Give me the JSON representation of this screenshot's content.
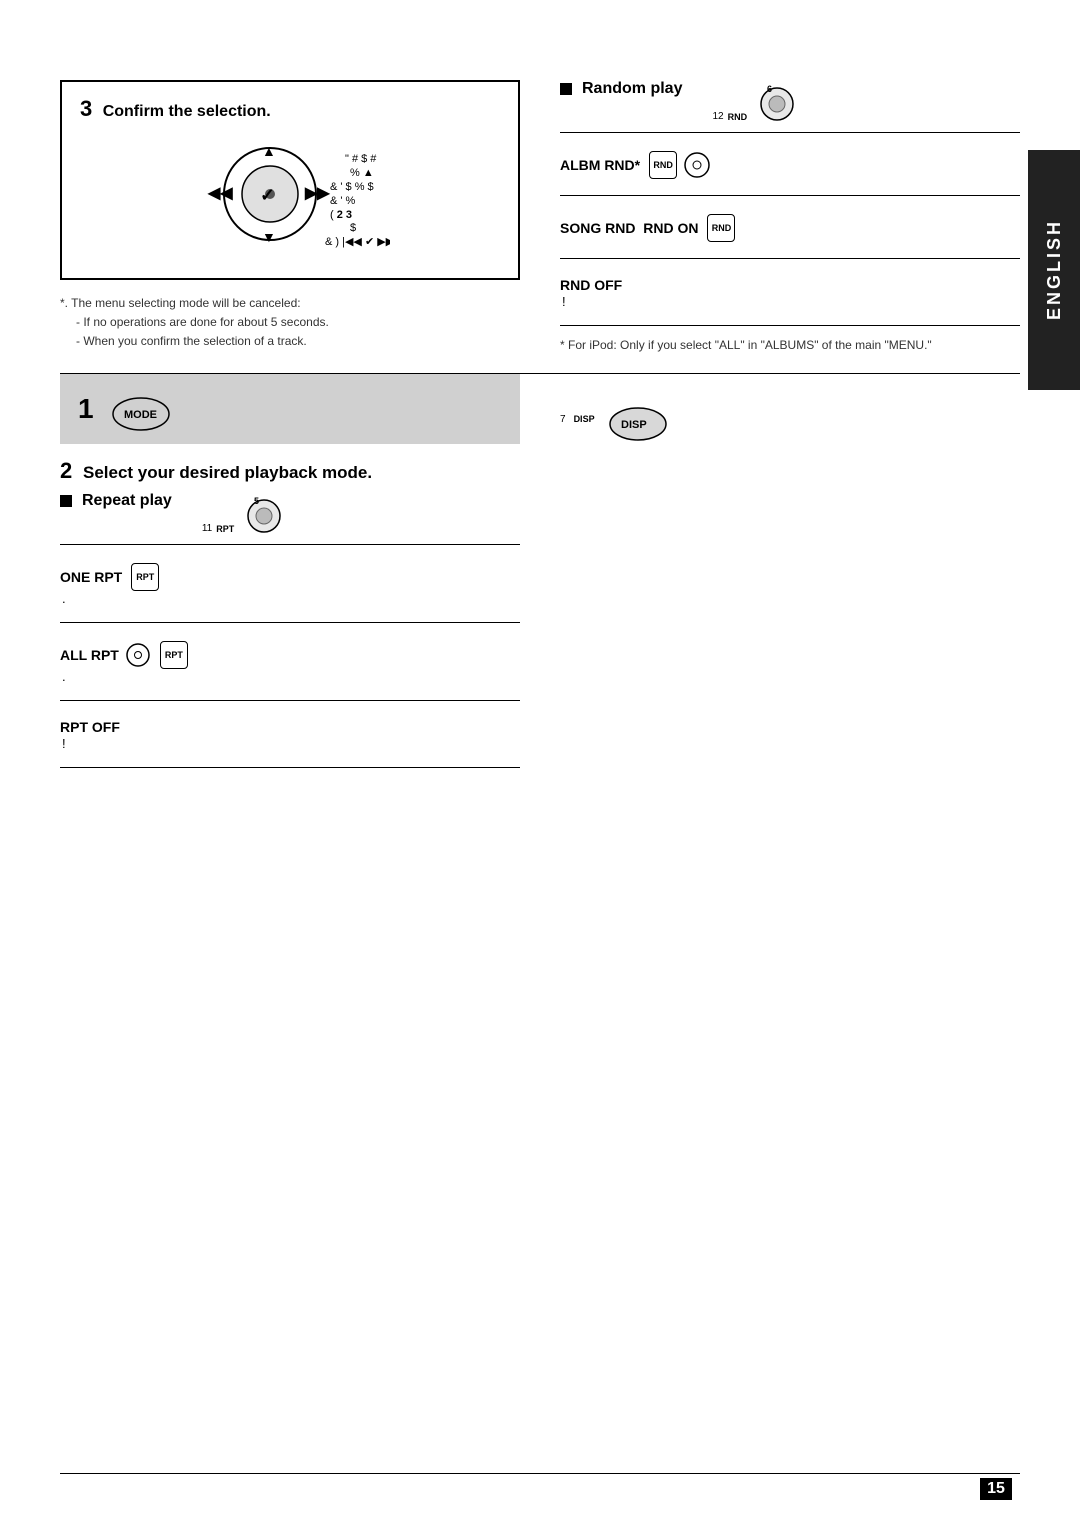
{
  "page": {
    "number": "15",
    "language_label": "ENGLISH"
  },
  "section_top": {
    "step3_title": "Confirm the selection.",
    "confirm_table": [
      {
        "key": "\" # $    #",
        "value": ""
      },
      {
        "key": "% ▲",
        "value": ""
      },
      {
        "key": "& '   $    %   $",
        "value": ""
      },
      {
        "key": "& '              %",
        "value": ""
      },
      {
        "key": "(",
        "value": "2    3"
      },
      {
        "key": "$",
        "value": ""
      },
      {
        "key": "& )  |◀◀ ✔ ▶▶|▲   $   *+",
        "value": ""
      }
    ],
    "footnote1": "*. The menu selecting mode will be canceled:",
    "footnote1a": "- If no operations are done for about 5 seconds.",
    "footnote1b": "- When you confirm the selection of a track."
  },
  "section_right_top": {
    "random_play_label": "Random play",
    "button_num": "12",
    "button_label": "RND",
    "albm_rnd_label": "ALBM RND*",
    "albm_rnd_badge": "RND",
    "albm_rnd_note": "",
    "song_rnd_label": "SONG RND  RND ON",
    "song_rnd_badge": "RND",
    "rnd_off_label": "RND OFF",
    "rnd_off_desc": "!",
    "footnote_star": "* For iPod: Only if you select \"ALL\" in \"ALBUMS\" of the main \"MENU.\""
  },
  "section_bottom_left": {
    "step1_label": "1",
    "mode_btn_label": "MODE",
    "step2_label": "2",
    "select_playback_label": "Select your desired playback mode.",
    "repeat_play_label": "Repeat play",
    "rpt_btn_num": "11",
    "rpt_btn_label": "RPT",
    "one_rpt_label": "ONE RPT",
    "one_rpt_badge": "RPT",
    "one_rpt_desc": ".",
    "all_rpt_label": "ALL RPT",
    "all_rpt_badge1": "",
    "all_rpt_badge2": "RPT",
    "all_rpt_desc": ".",
    "rpt_off_label": "RPT OFF",
    "rpt_off_desc": "!"
  },
  "section_bottom_right": {
    "disp_btn_num": "7",
    "disp_btn_label": "DISP"
  }
}
